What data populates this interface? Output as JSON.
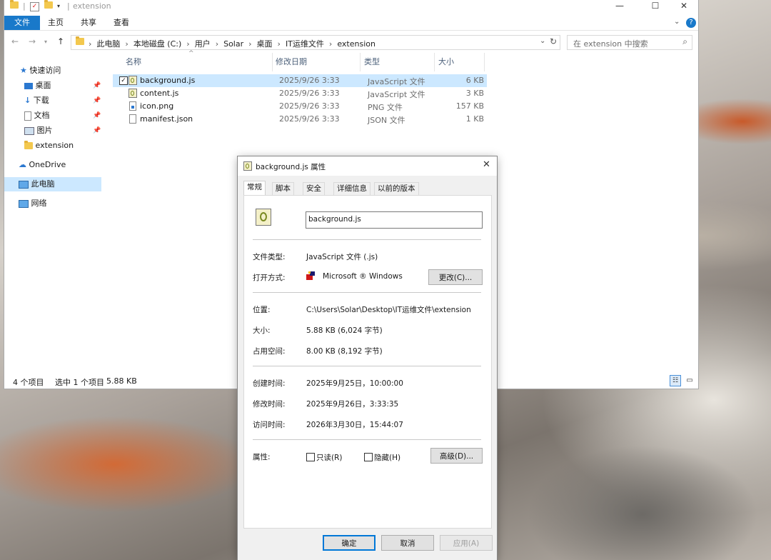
{
  "explorer": {
    "window_title": "extension",
    "ribbon_tabs": [
      "文件",
      "主页",
      "共享",
      "查看"
    ],
    "breadcrumb": [
      "此电脑",
      "本地磁盘 (C:)",
      "用户",
      "Solar",
      "桌面",
      "IT运维文件",
      "extension"
    ],
    "search_placeholder": "在 extension 中搜索",
    "sidebar": [
      {
        "label": "快速访问",
        "icon": "star-icon"
      },
      {
        "label": "桌面",
        "icon": "desktop-icon",
        "pinned": true
      },
      {
        "label": "下载",
        "icon": "download-icon",
        "pinned": true
      },
      {
        "label": "文档",
        "icon": "document-icon",
        "pinned": true
      },
      {
        "label": "图片",
        "icon": "picture-icon",
        "pinned": true
      },
      {
        "label": "extension",
        "icon": "folder-icon"
      },
      {
        "label": "OneDrive",
        "icon": "cloud-icon"
      },
      {
        "label": "此电脑",
        "icon": "computer-icon",
        "selected": true
      },
      {
        "label": "网络",
        "icon": "network-icon"
      }
    ],
    "columns": [
      "名称",
      "修改日期",
      "类型",
      "大小"
    ],
    "files": [
      {
        "name": "background.js",
        "date": "2025/9/26 3:33",
        "type": "JavaScript 文件",
        "size": "6 KB",
        "selected": true
      },
      {
        "name": "content.js",
        "date": "2025/9/26 3:33",
        "type": "JavaScript 文件",
        "size": "3 KB"
      },
      {
        "name": "icon.png",
        "date": "2025/9/26 3:33",
        "type": "PNG 文件",
        "size": "157 KB"
      },
      {
        "name": "manifest.json",
        "date": "2025/9/26 3:33",
        "type": "JSON 文件",
        "size": "1 KB"
      }
    ],
    "status": {
      "count": "4 个项目",
      "selection": "选中 1 个项目",
      "size": "5.88 KB"
    }
  },
  "dialog": {
    "title": "background.js 属性",
    "tabs": [
      "常规",
      "脚本",
      "安全",
      "详细信息",
      "以前的版本"
    ],
    "filename": "background.js",
    "type_label": "文件类型:",
    "type_value": "JavaScript 文件 (.js)",
    "open_label": "打开方式:",
    "open_value": "Microsoft ® Windows",
    "change_button": "更改(C)...",
    "location_label": "位置:",
    "location_value": "C:\\Users\\Solar\\Desktop\\IT运维文件\\extension",
    "size_label": "大小:",
    "size_value": "5.88 KB (6,024 字节)",
    "disk_label": "占用空间:",
    "disk_value": "8.00 KB (8,192 字节)",
    "created_label": "创建时间:",
    "created_value": "2025年9月25日，10:00:00",
    "modified_label": "修改时间:",
    "modified_value": "2025年9月26日，3:33:35",
    "accessed_label": "访问时间:",
    "accessed_value": "2026年3月30日，15:44:07",
    "attr_label": "属性:",
    "readonly_label": "只读(R)",
    "hidden_label": "隐藏(H)",
    "advanced_button": "高级(D)...",
    "ok_button": "确定",
    "cancel_button": "取消",
    "apply_button": "应用(A)"
  }
}
